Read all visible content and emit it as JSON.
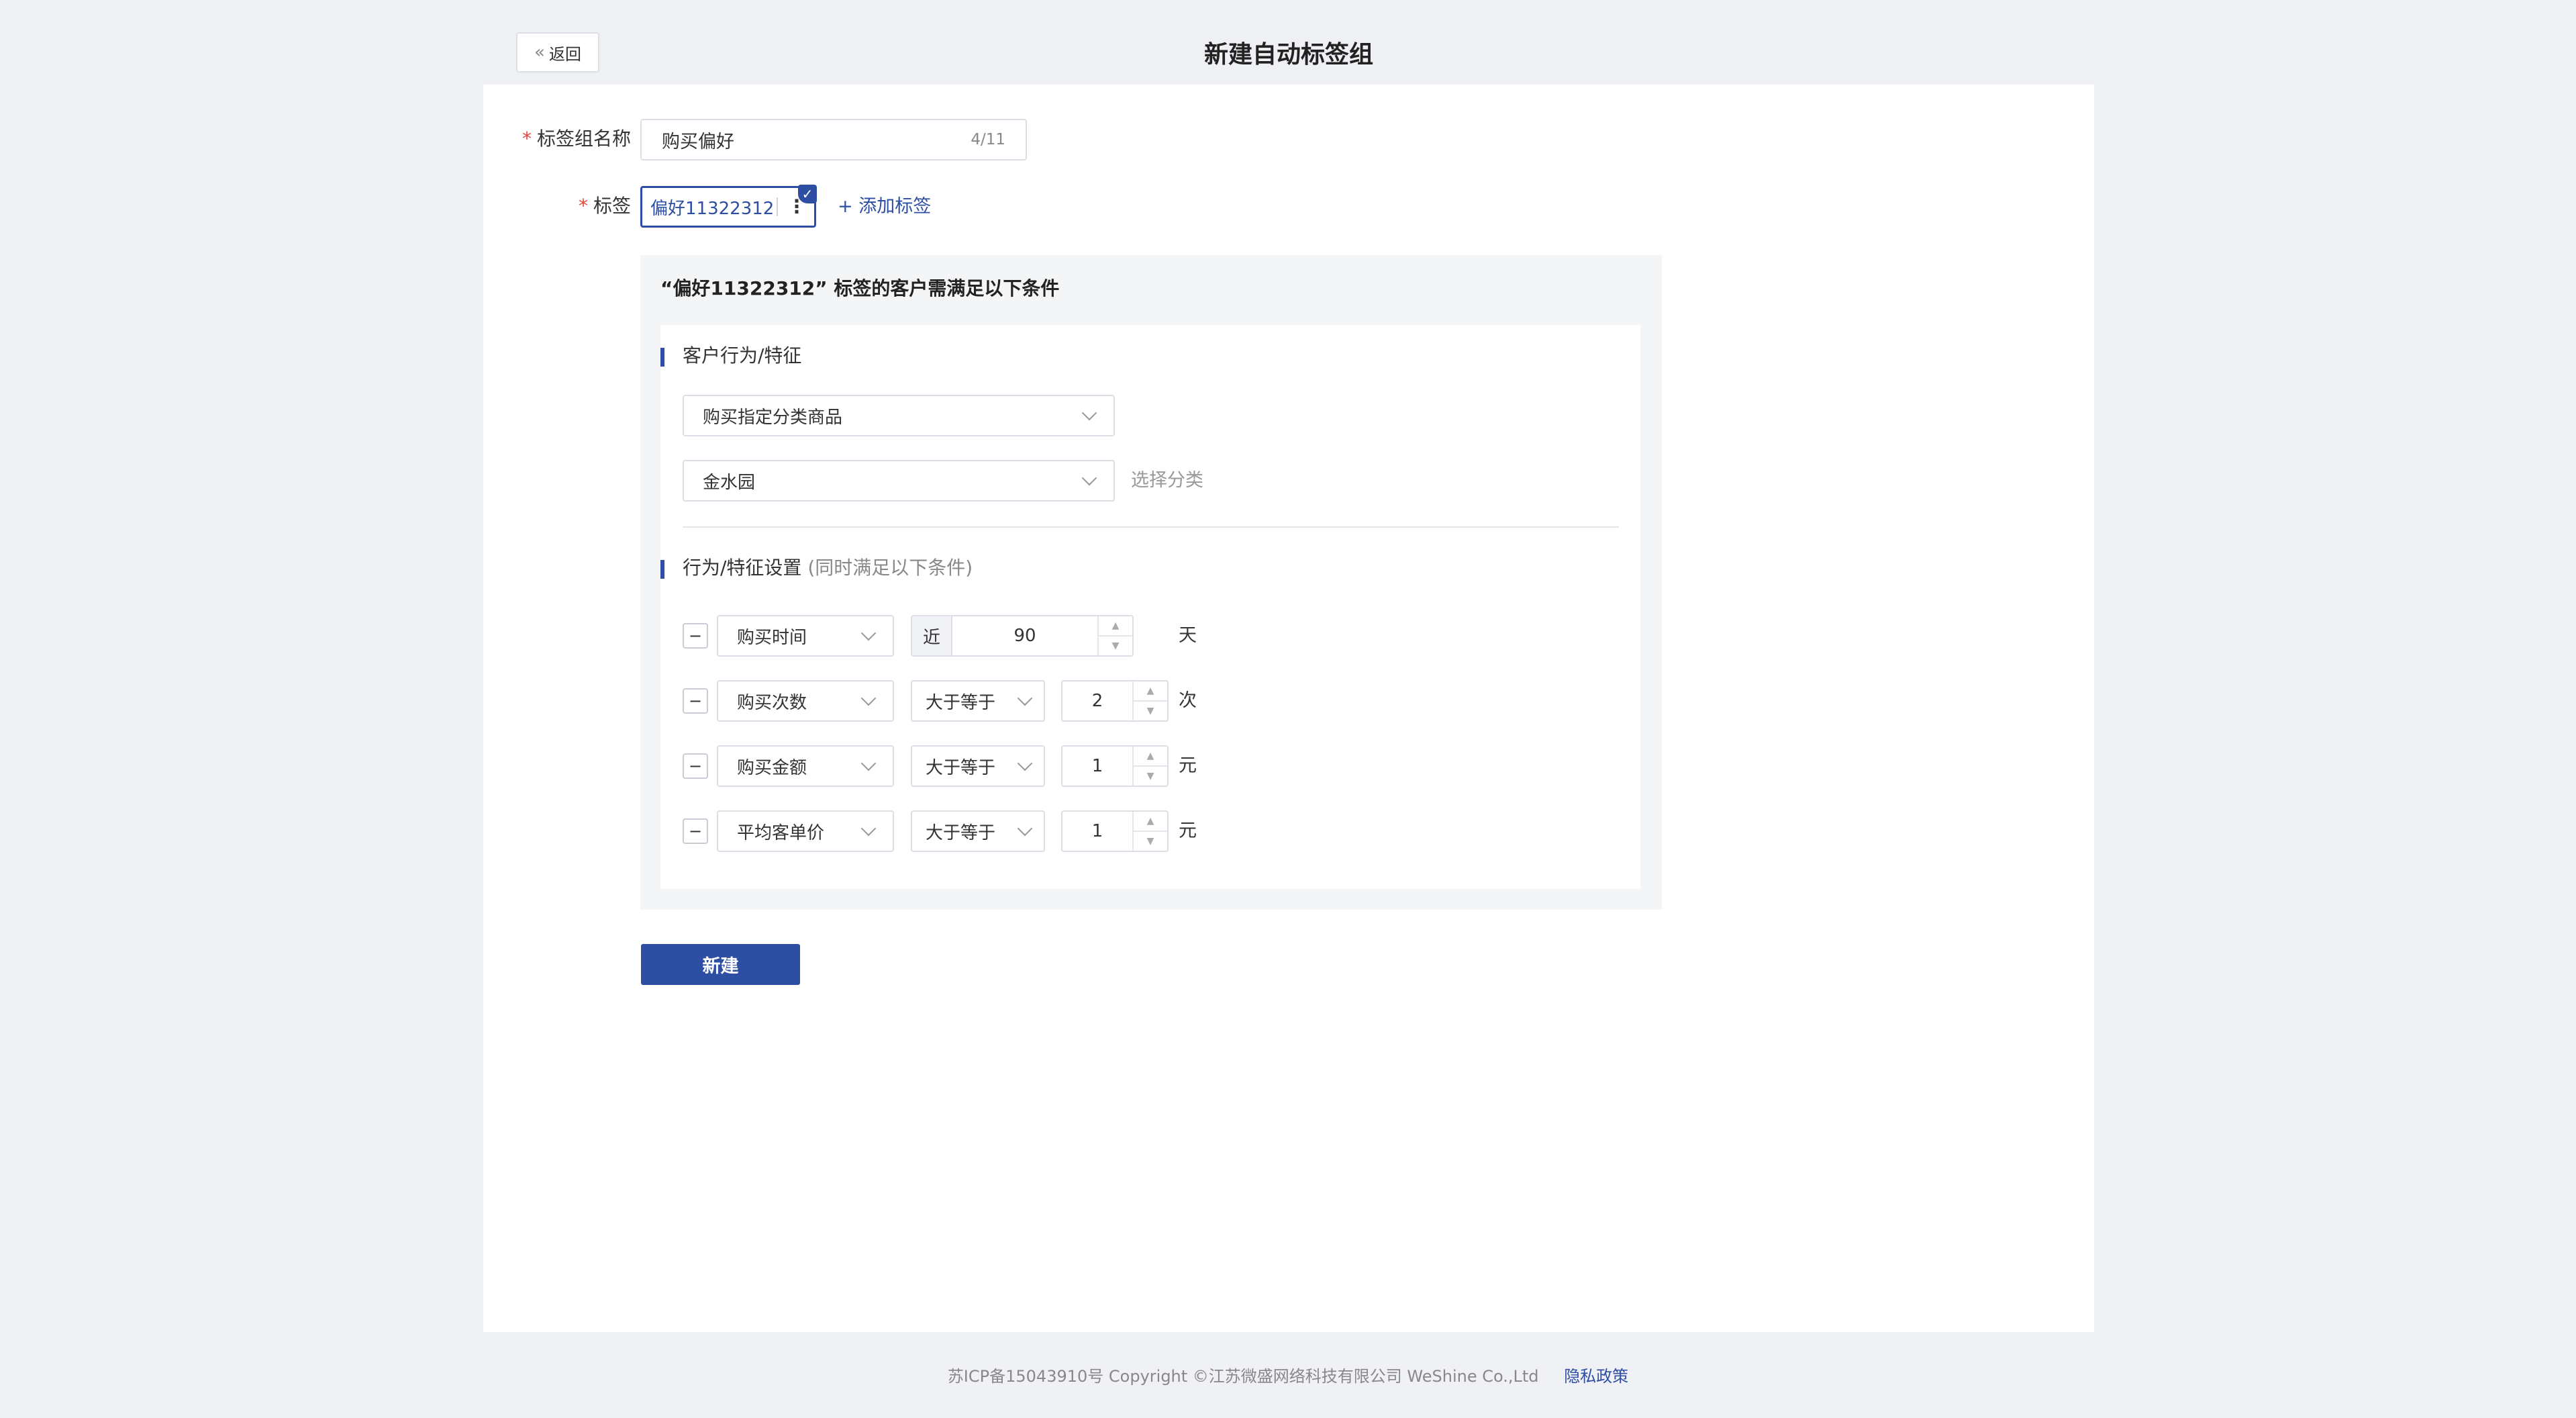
{
  "header": {
    "back_label": "返回",
    "title": "新建自动标签组"
  },
  "form": {
    "name_label": "标签组名称",
    "name_value": "购买偏好",
    "name_count": "4/11",
    "tag_label": "标签",
    "tag_chip": "偏好11322312",
    "add_tag": "+ 添加标签",
    "required_mark": "*"
  },
  "conditions": {
    "title": "“偏好11322312” 标签的客户需满足以下条件",
    "behavior_section": "客户行为/特征",
    "behavior_select": "购买指定分类商品",
    "category_select": "金水园",
    "category_hint": "选择分类",
    "settings_section": "行为/特征设置",
    "settings_hint": "(同时满足以下条件)",
    "rows": [
      {
        "field": "购买时间",
        "prefix": "近",
        "value": "90",
        "unit": "天"
      },
      {
        "field": "购买次数",
        "operator": "大于等于",
        "value": "2",
        "unit": "次"
      },
      {
        "field": "购买金额",
        "operator": "大于等于",
        "value": "1",
        "unit": "元"
      },
      {
        "field": "平均客单价",
        "operator": "大于等于",
        "value": "1",
        "unit": "元"
      }
    ]
  },
  "actions": {
    "create_label": "新建"
  },
  "footer": {
    "copyright": "苏ICP备15043910号 Copyright ©江苏微盛网络科技有限公司 WeShine Co.,Ltd",
    "privacy": "隐私政策"
  },
  "colors": {
    "primary": "#2e4ea4",
    "required": "#e2453c",
    "background": "#f0f1f5"
  }
}
